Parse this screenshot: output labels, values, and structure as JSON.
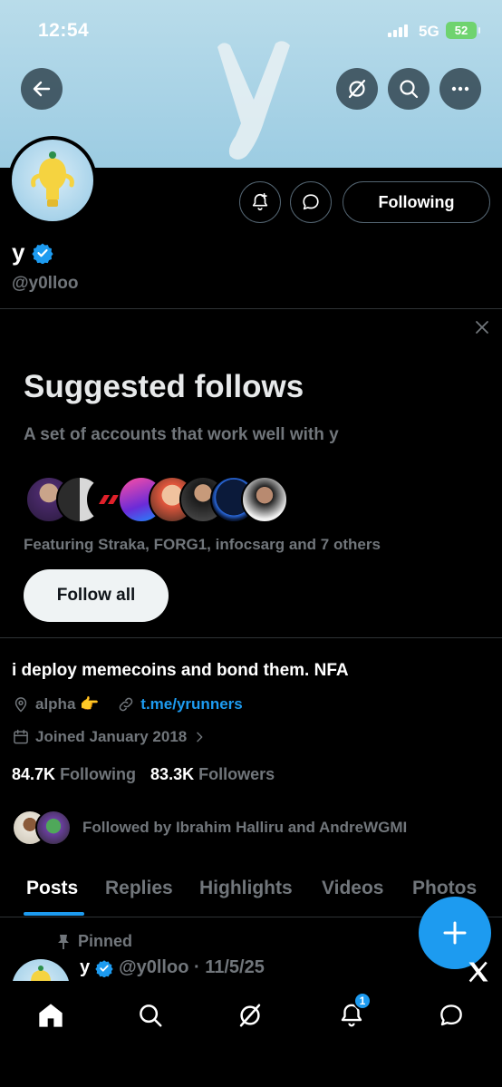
{
  "status_bar": {
    "time": "12:54",
    "network": "5G",
    "battery": "52"
  },
  "header": {
    "back_icon": "arrow-left-icon",
    "grok_icon": "grok-icon",
    "search_icon": "search-icon",
    "more_icon": "more-icon"
  },
  "profile": {
    "display_name": "y",
    "handle": "@y0lloo",
    "following_button": "Following",
    "bio": "i deploy memecoins and bond them. NFA",
    "location": "alpha 👉",
    "website": "t.me/yrunners",
    "joined": "Joined January 2018",
    "following_count": "84.7K",
    "following_label": "Following",
    "followers_count": "83.3K",
    "followers_label": "Followers",
    "followed_by": "Followed by Ibrahim Halliru and AndreWGMI"
  },
  "suggested": {
    "title": "Suggested follows",
    "subtitle": "A set of accounts that work well with y",
    "featuring": "Featuring Straka, FORG1, infocsarg and 7 others",
    "follow_all": "Follow all"
  },
  "tabs": [
    "Posts",
    "Replies",
    "Highlights",
    "Videos",
    "Photos"
  ],
  "pinned_post": {
    "pinned_label": "Pinned",
    "name": "y",
    "handle_date": "@y0lloo · 11/5/25"
  },
  "bottom_nav": {
    "notifications_badge": "1"
  },
  "colors": {
    "accent": "#1d9bf0",
    "background": "#000000",
    "muted": "#71767b"
  }
}
